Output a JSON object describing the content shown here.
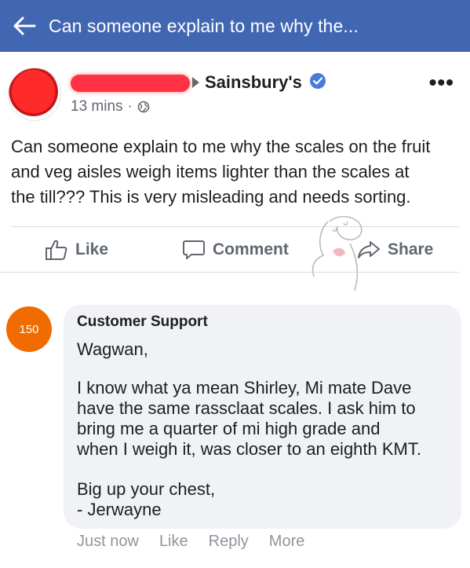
{
  "topbar": {
    "title": "Can someone explain to me why the...",
    "back_icon": "back-arrow-icon"
  },
  "post": {
    "page_name": "Sainsbury's",
    "time": "13 mins",
    "separator": "·",
    "lines": [
      "Can someone explain to me why the scales on the fruit",
      "and veg aisles weigh items lighter than the scales at",
      "the till??? This is very misleading and needs sorting."
    ]
  },
  "actions": {
    "like": "Like",
    "comment": "Comment",
    "share": "Share"
  },
  "comment": {
    "avatar_text": "150",
    "author": "Customer Support",
    "lines": [
      "Wagwan,",
      "",
      "I know what ya mean Shirley, Mi mate Dave",
      "have the same rassclaat scales. I ask him to",
      "bring me a quarter of mi high grade and",
      "when I weigh it, was closer to an eighth KMT.",
      "",
      "Big up your chest,",
      "- Jerwayne"
    ],
    "time": "Just now",
    "like": "Like",
    "reply": "Reply",
    "more": "More"
  },
  "colors": {
    "topbar": "#4267b2",
    "verified": "#4a7bd8",
    "avatar_orange": "#f06c00"
  }
}
